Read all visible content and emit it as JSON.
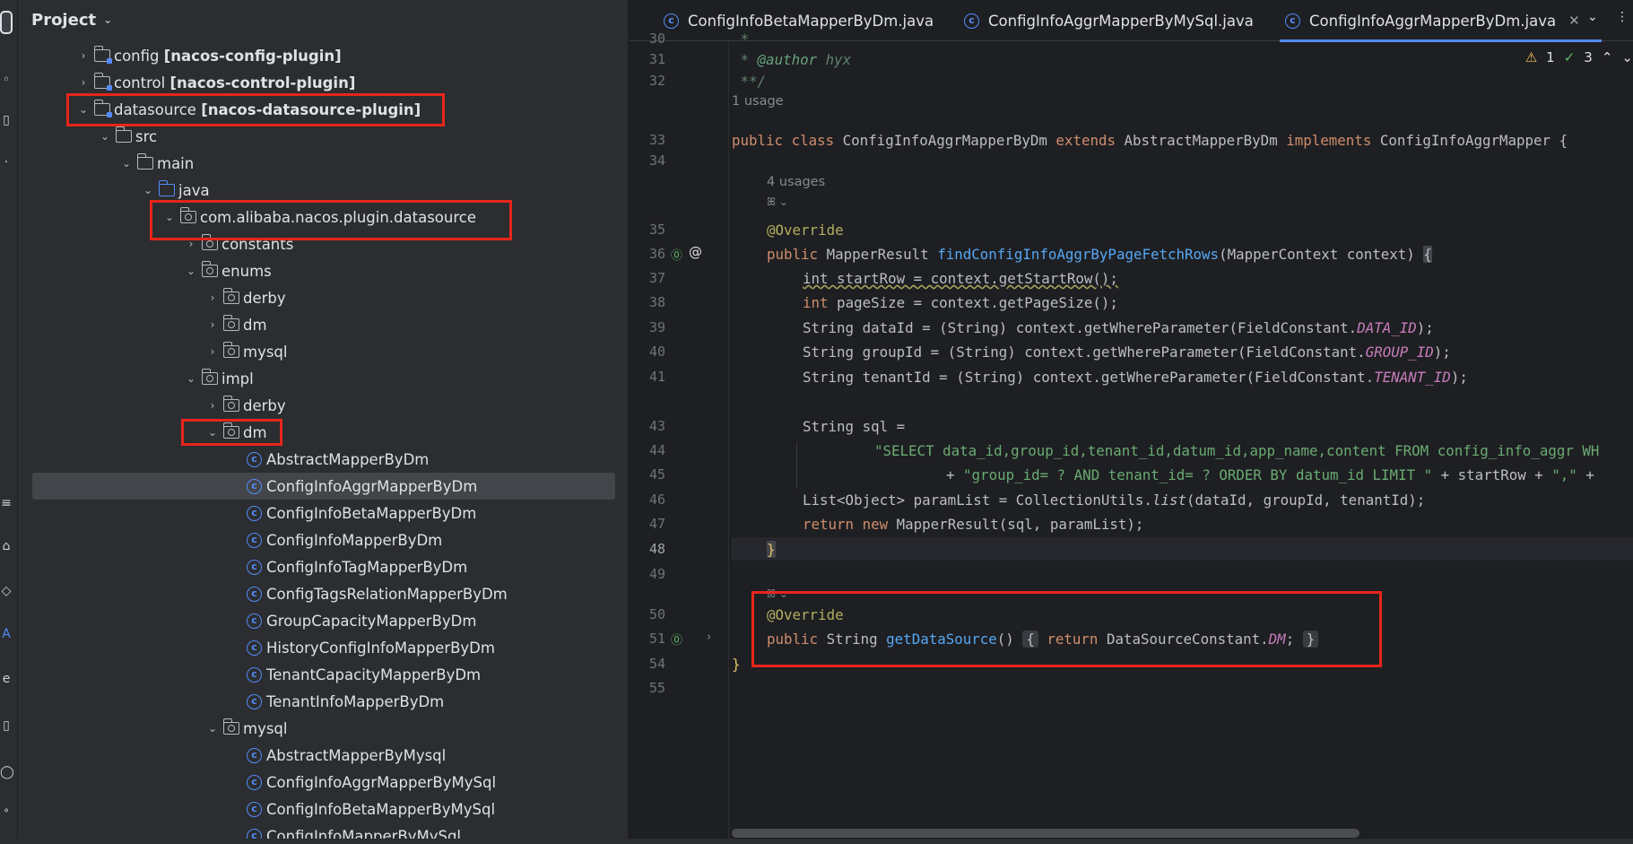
{
  "project": {
    "title": "Project",
    "tree": [
      {
        "label": "config",
        "module": "[nacos-config-plugin]",
        "expanded": false
      },
      {
        "label": "control",
        "module": "[nacos-control-plugin]",
        "expanded": false
      },
      {
        "label": "datasource",
        "module": "[nacos-datasource-plugin]",
        "expanded": true
      },
      {
        "label": "src"
      },
      {
        "label": "main"
      },
      {
        "label": "java"
      },
      {
        "label": "com.alibaba.nacos.plugin.datasource"
      },
      {
        "label": "constants"
      },
      {
        "label": "enums"
      },
      {
        "label": "derby"
      },
      {
        "label": "dm"
      },
      {
        "label": "mysql"
      },
      {
        "label": "impl"
      },
      {
        "label": "derby"
      },
      {
        "label": "dm"
      },
      {
        "label": "AbstractMapperByDm"
      },
      {
        "label": "ConfigInfoAggrMapperByDm"
      },
      {
        "label": "ConfigInfoBetaMapperByDm"
      },
      {
        "label": "ConfigInfoMapperByDm"
      },
      {
        "label": "ConfigInfoTagMapperByDm"
      },
      {
        "label": "ConfigTagsRelationMapperByDm"
      },
      {
        "label": "GroupCapacityMapperByDm"
      },
      {
        "label": "HistoryConfigInfoMapperByDm"
      },
      {
        "label": "TenantCapacityMapperByDm"
      },
      {
        "label": "TenantInfoMapperByDm"
      },
      {
        "label": "mysql"
      },
      {
        "label": "AbstractMapperByMysql"
      },
      {
        "label": "ConfigInfoAggrMapperByMySql"
      },
      {
        "label": "ConfigInfoBetaMapperByMySql"
      },
      {
        "label": "ConfigInfoMapperByMySql"
      }
    ]
  },
  "editor": {
    "tabs": [
      {
        "label": "ConfigInfoBetaMapperByDm.java"
      },
      {
        "label": "ConfigInfoAggrMapperByMySql.java"
      },
      {
        "label": "ConfigInfoAggrMapperByDm.java",
        "active": true
      }
    ],
    "inspections": {
      "warnings": "1",
      "weak": "3"
    },
    "line_numbers": [
      "30",
      "31",
      "32",
      "33",
      "34",
      "35",
      "36",
      "37",
      "38",
      "39",
      "40",
      "41",
      "43",
      "44",
      "45",
      "46",
      "47",
      "48",
      "49",
      "50",
      "51",
      "54",
      "55"
    ],
    "hints": {
      "usage1": "1 usage",
      "usages4": "4 usages"
    },
    "code": {
      "l30": " *",
      "l31_a": " * ",
      "l31_tag": "@author",
      "l31_b": " hyx",
      "l32": " **/",
      "l33_kw1": "public class ",
      "l33_name": "ConfigInfoAggrMapperByDm",
      "l33_kw2": " extends ",
      "l33_base": "AbstractMapperByDm",
      "l33_kw3": " implements ",
      "l33_iface": "ConfigInfoAggrMapper {",
      "l35": "@Override",
      "l36_kw": "public ",
      "l36_type": "MapperResult ",
      "l36_fn": "findConfigInfoAggrByPageFetchRows",
      "l36_params": "(MapperContext context) ",
      "l36_brace": "{",
      "l37": "int startRow = context.getStartRow();",
      "l38_kw": "int",
      "l38_rest": " pageSize = context.getPageSize();",
      "l39_a": "String dataId = (String) context.getWhereParameter(FieldConstant.",
      "l39_f": "DATA_ID",
      "l39_b": ");",
      "l40_a": "String groupId = (String) context.getWhereParameter(FieldConstant.",
      "l40_f": "GROUP_ID",
      "l40_b": ");",
      "l41_a": "String tenantId = (String) context.getWhereParameter(FieldConstant.",
      "l41_f": "TENANT_ID",
      "l41_b": ");",
      "l43": "String sql =",
      "l44": "\"SELECT data_id,group_id,tenant_id,datum_id,app_name,content FROM config_info_aggr WH",
      "l45_a": "+ ",
      "l45_s": "\"group_id= ? AND tenant_id= ? ORDER BY datum_id LIMIT \"",
      "l45_b": " + startRow + ",
      "l45_s2": "\",\"",
      "l45_c": " +",
      "l46_a": "List<Object> paramList = CollectionUtils.",
      "l46_it": "list",
      "l46_b": "(dataId, groupId, tenantId);",
      "l47_kw": "return new ",
      "l47_rest": "MapperResult(sql, paramList);",
      "l48": "}",
      "l50": "@Override",
      "l51_kw": "public ",
      "l51_type": "String ",
      "l51_fn": "getDataSource",
      "l51_p": "() ",
      "l51_o": "{",
      "l51_ret": " return ",
      "l51_rest": "DataSourceConstant.",
      "l51_f": "DM",
      "l51_semi": "; ",
      "l51_c": "}",
      "l54": "}"
    }
  },
  "colors": {
    "highlight_box": "#e8251b",
    "accent": "#548af7"
  }
}
